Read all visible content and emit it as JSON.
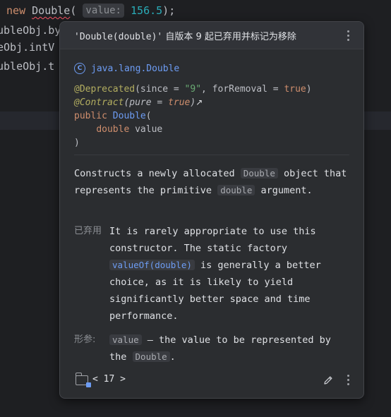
{
  "editor": {
    "line1": {
      "prefix": " new ",
      "class_name": "Double",
      "open_paren": "(",
      "hint": "value:",
      "number": "156.5",
      "suffix": ");"
    },
    "line2": "ubleObj.by",
    "line3": "eObj.intV",
    "line4": "ubleObj.t"
  },
  "popup": {
    "header": {
      "signature": "'Double(double)'",
      "message": " 自版本 9 起已弃用并标记为移除"
    },
    "package": {
      "icon": "class-icon",
      "icon_glyph": "C",
      "name": "java.lang.Double"
    },
    "signature": {
      "annotation1": "@Deprecated",
      "annotation1_args_open": "(since = ",
      "since_value": "\"9\"",
      "for_removal": ", forRemoval = ",
      "for_removal_value": "true",
      "annotation1_close": ")",
      "annotation2": "@Contract",
      "annotation2_open": "(",
      "pure_key": "pure = ",
      "pure_value": "true",
      "annotation2_close": ")",
      "external_link_glyph": "↗",
      "modifier": "public",
      "ctor_name": "Double",
      "ctor_open": "(",
      "param_type": "double",
      "param_name": " value",
      "ctor_close": ")"
    },
    "description": {
      "part1": "Constructs a newly allocated ",
      "code1": "Double",
      "part2": " object that represents the primitive ",
      "code2": "double",
      "part3": " argument."
    },
    "deprecated": {
      "label": "已弃用",
      "part1": "It is rarely appropriate to use this constructor. The static factory ",
      "link": "valueOf(double)",
      "part2": " is generally a better choice, as it is likely to yield significantly better space and time performance."
    },
    "params": {
      "label": "形参:",
      "code1": "value",
      "part1": " – the value to be represented by the ",
      "code2": "Double",
      "part2": "."
    },
    "footer": {
      "folder_icon": "library-folder-icon",
      "prev": "<",
      "version": "17",
      "next": ">",
      "edit_icon": "pencil-icon",
      "more_icon": "kebab-icon"
    }
  }
}
